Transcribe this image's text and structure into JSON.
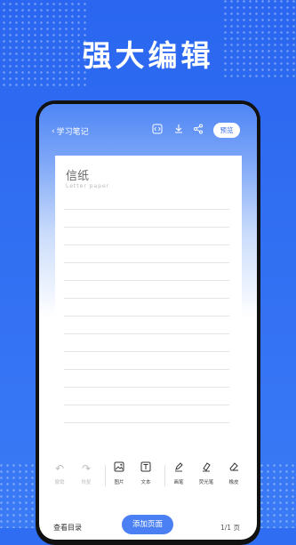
{
  "headline": "强大编辑",
  "colors": {
    "background": "#2f6df2",
    "accent": "#4a80f3",
    "phone_frame": "#111111"
  },
  "app": {
    "back_label": "学习笔记",
    "icons": [
      "code-icon",
      "download-icon",
      "share-icon"
    ],
    "preview_label": "预览"
  },
  "paper": {
    "title": "信纸",
    "subtitle": "Letter paper"
  },
  "toolbar": {
    "undo": "撤销",
    "redo": "恢复",
    "image": "图片",
    "text": "文本",
    "brush": "画笔",
    "highlighter": "荧光笔",
    "eraser": "橡皮"
  },
  "bottom": {
    "catalog": "查看目录",
    "add_page": "添加页面",
    "pager": "1/1 页"
  }
}
